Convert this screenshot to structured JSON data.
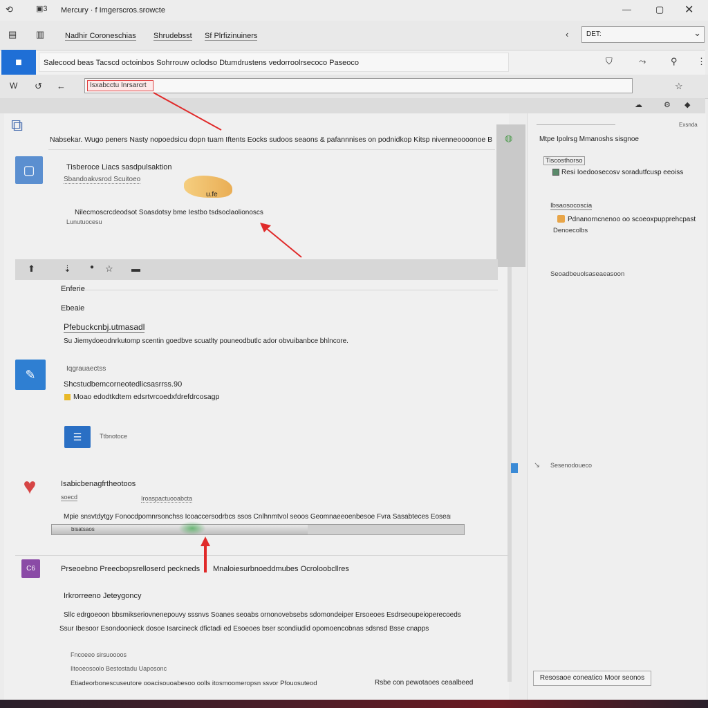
{
  "window": {
    "title": "Mercury · f Imgerscros.srowcte",
    "controls": [
      "―",
      "▢",
      "✕"
    ]
  },
  "menubar": {
    "items": [
      "Nadhir Coroneschias",
      "Shrudebsst",
      "Sf Plrfizinuiners"
    ],
    "dropdown_value": "DET:"
  },
  "infobar": {
    "text": "Salecood beas Tacscd octoinbos Sohrrouw oclodso Dtumdrustens vedorroolrsecoco Paseoco"
  },
  "addressbar": {
    "buttons": [
      "W",
      "↺",
      "←"
    ],
    "highlighted_text": "Isxabcctu Inrsarcrt"
  },
  "left": {
    "header_line": "Nabsekar. Wugo peners Nasty nopoedsicu dopn tuam Iftents Eocks sudoos seaons & pafannnises on podnidkop Kitsp nivenneoooonoe Bodsdnanctiorns BOH",
    "card1": {
      "title": "Tisberoce  Liacs sasdpulsaktion",
      "subtitle": "Sbandoakvsrod Scuitoeo",
      "badge": "u.fe",
      "line": "Nilecmoscrcdeodsot Soasdotsy bme Iestbo tsdsoclaolionoscs",
      "small": "Lunutuocesu"
    },
    "toolbar2": [
      "⬆",
      "⇣",
      "●",
      "☆",
      "▬"
    ],
    "section": {
      "label1": "Enferie",
      "label2": "Ebeaie",
      "title": "Pfebuckcnbj.utmasadl",
      "desc": "Su Jiemydoeodnrkutomp scentin goedbve scuatlty pouneodbutlc ador obvuibanbce bhlncore."
    },
    "item2": {
      "sub": "Iqgrauaectss",
      "title": "Shcstudbemcorneotedlicsasrrss.90",
      "line": "Moao edodtkdtem edsrtvrcoedxfdrefdrcosagp",
      "sub2": "Ttbnotoce"
    },
    "item3": {
      "title": "Isabicbenagfrtheotoos",
      "sub": "soecd",
      "meta": "Iroaspactuooabcta",
      "line": "Mpie snsvtdytgy Fonocdpomnrsonchss Icoaccersodrbcs ssos Cnlhnmtvol seoos Geomnaeeoenbesoe Fvra Sasabteces Eoseanornsk",
      "progress_label": "bisatsaos",
      "progress": 0.62
    },
    "item4": {
      "icon_text": "C6",
      "title": "Prseoebno Preecbopsrelloserd peckneds",
      "title2": "Mnaloiesurbnoeddmubes Ocroloobcllres",
      "sub": "Irkrorreeno Jeteygoncy",
      "line1": "Sllc edrgoeoon bbsmikseriovnenepouvy sssnvs Soanes seoabs ornonovebsebs sdomondeiper Ersoeoes Esdrseoupeioperecoeds",
      "line2": "Ssur Ibesoor Esondoonieck dosoe Isarcineck dfictadi ed Esoeoes bser scondiudid opomoencobnas sdsnsd Bsse cnapps",
      "bullets": [
        "Fncoeeo sirsuoooos",
        "Iltooeosoolo Bestostadu Uaposonc",
        "Etiadeorbonescuseutore ooacisouoabesoo oolls itosmoomeropsn ssvor Pfouosuteod"
      ],
      "footer_right": "Rsbe con pewotaoes ceaalbeed"
    }
  },
  "right": {
    "header": "Mtpe Ipolrsg Mmanoshs sisgnoe",
    "group1_label": "Tiscosthorso",
    "group1_line": "Resi Ioedoosecosv soradutfcusp eeoiss",
    "group2_label": "Ibsaosocoscia",
    "group2_line": "Pdnanorncnenoo oo scoeoxpupprehcpast",
    "group2_sub": "Denoecolbs",
    "link": "Seoadbeuolsaseaeasoon",
    "mini": "Sesenodoueco",
    "corner": "Exsnda",
    "button": "Resosaoe coneatico Moor seonos"
  },
  "icons": [
    "menu-icon",
    "window-icon",
    "search-icon",
    "settings-icon",
    "user-icon",
    "pin-icon",
    "star-icon",
    "back-icon",
    "refresh-icon",
    "cloud-icon",
    "app-icon-blue",
    "app-icon-pen",
    "app-icon-doc",
    "app-icon-heart",
    "app-icon-purple"
  ],
  "colors": {
    "accent_blue": "#1f6fd6",
    "annotation_red": "#e02a2a",
    "purple": "#8a4aa6",
    "heart_red": "#d64545"
  }
}
